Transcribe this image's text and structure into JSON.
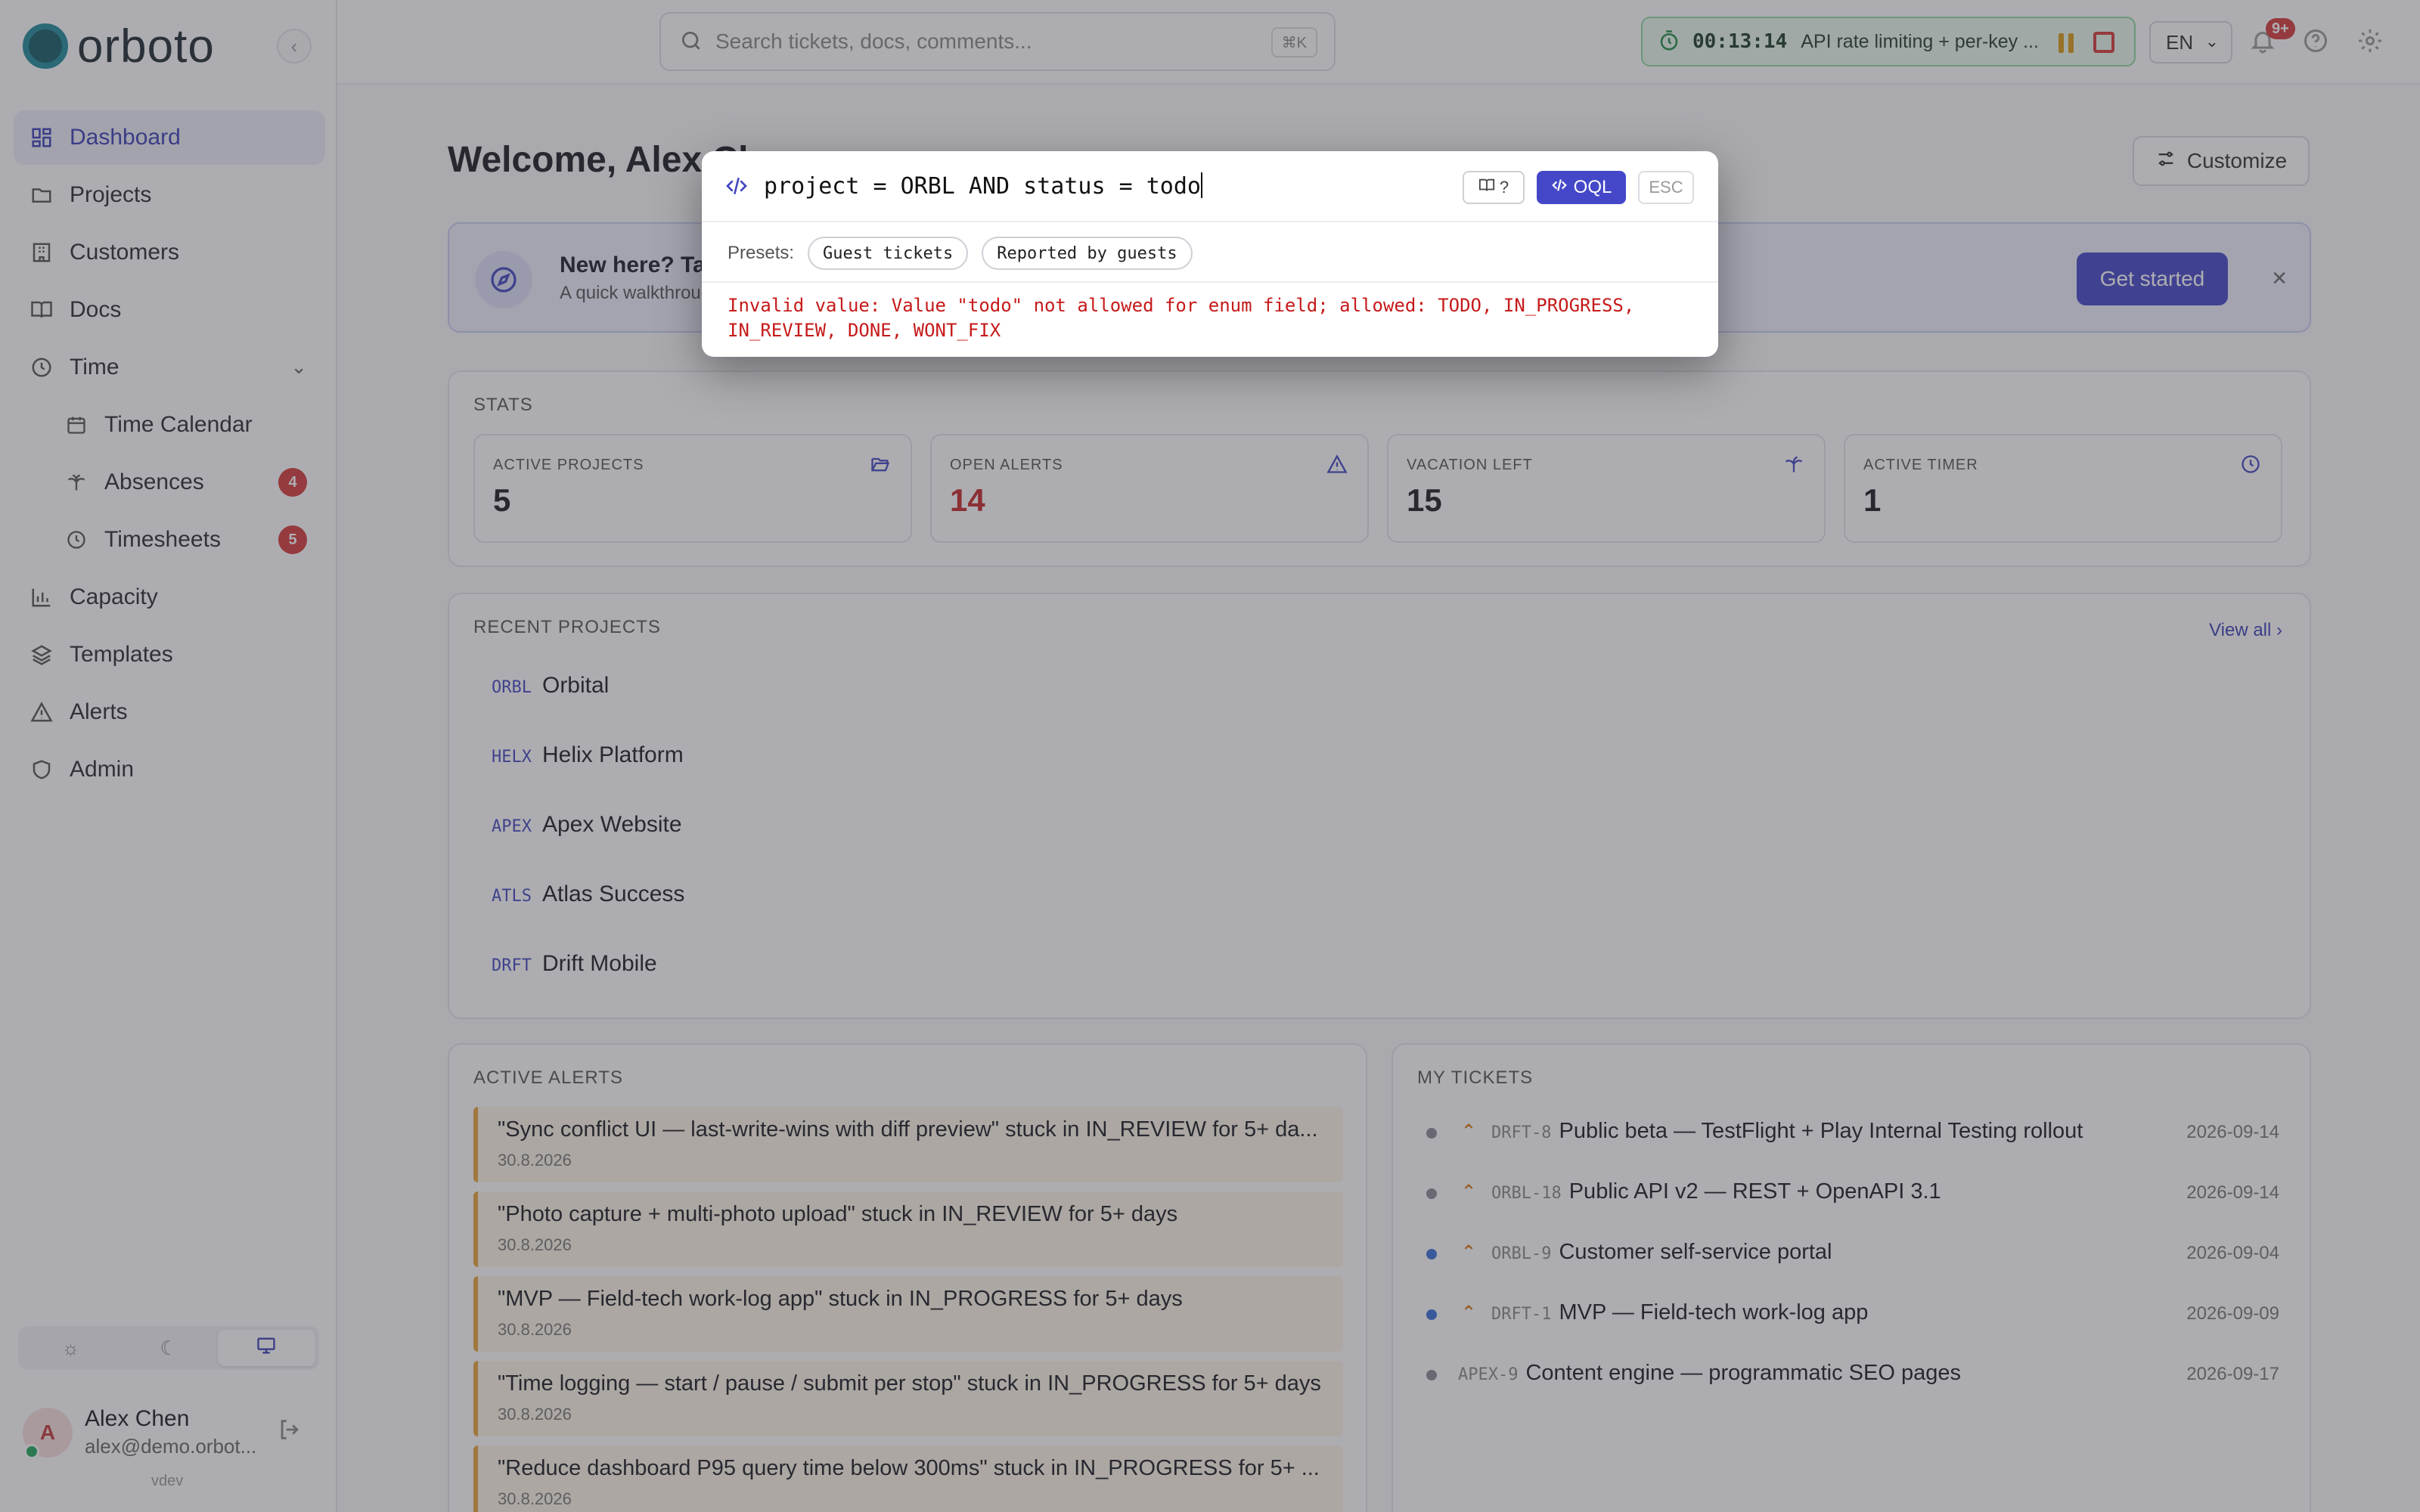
{
  "app": {
    "name": "orboto",
    "env": "vdev"
  },
  "sidebar": {
    "items": [
      {
        "label": "Dashboard",
        "icon": "dashboard-icon",
        "active": true
      },
      {
        "label": "Projects",
        "icon": "folder-icon"
      },
      {
        "label": "Customers",
        "icon": "building-icon"
      },
      {
        "label": "Docs",
        "icon": "book-icon"
      },
      {
        "label": "Time",
        "icon": "clock-icon",
        "expanded": true
      },
      {
        "label": "Time Calendar",
        "icon": "calendar-icon",
        "sub": true
      },
      {
        "label": "Absences",
        "icon": "palm-tree-icon",
        "sub": true,
        "badge": "4"
      },
      {
        "label": "Timesheets",
        "icon": "clock-icon",
        "sub": true,
        "badge": "5"
      },
      {
        "label": "Capacity",
        "icon": "bar-chart-icon"
      },
      {
        "label": "Templates",
        "icon": "layers-icon"
      },
      {
        "label": "Alerts",
        "icon": "alert-triangle-icon"
      },
      {
        "label": "Admin",
        "icon": "shield-icon"
      }
    ],
    "theme_options": [
      "light",
      "dark",
      "system"
    ],
    "theme_selected": "system"
  },
  "user": {
    "initial": "A",
    "name": "Alex Chen",
    "email": "alex@demo.orbot..."
  },
  "topbar": {
    "search_placeholder": "Search tickets, docs, comments...",
    "search_shortcut": "⌘K",
    "timer_time": "00:13:14",
    "timer_label": "API rate limiting + per-key ...",
    "language": "EN",
    "notifications_badge": "9+"
  },
  "main": {
    "welcome": "Welcome, Alex Chen",
    "customize_label": "Customize",
    "banner": {
      "title": "New here? Take a quick tour",
      "subtitle": "A quick walkthrough of the main features",
      "cta": "Get started"
    },
    "stats_title": "STATS",
    "stats": [
      {
        "label": "ACTIVE PROJECTS",
        "value": "5",
        "icon": "folder-open-icon"
      },
      {
        "label": "OPEN ALERTS",
        "value": "14",
        "icon": "alert-triangle-icon",
        "color": "#c62828"
      },
      {
        "label": "VACATION LEFT",
        "value": "15",
        "icon": "palm-tree-icon"
      },
      {
        "label": "ACTIVE TIMER",
        "value": "1",
        "icon": "clock-icon"
      }
    ],
    "recent_title": "RECENT PROJECTS",
    "view_all": "View all",
    "projects": [
      {
        "key": "ORBL",
        "name": "Orbital"
      },
      {
        "key": "HELX",
        "name": "Helix Platform"
      },
      {
        "key": "APEX",
        "name": "Apex Website"
      },
      {
        "key": "ATLS",
        "name": "Atlas Success"
      },
      {
        "key": "DRFT",
        "name": "Drift Mobile"
      }
    ],
    "alerts_title": "ACTIVE ALERTS",
    "alerts": [
      {
        "text": "\"Sync conflict UI — last-write-wins with diff preview\" stuck in IN_REVIEW for 5+ da...",
        "date": "30.8.2026"
      },
      {
        "text": "\"Photo capture + multi-photo upload\" stuck in IN_REVIEW for 5+ days",
        "date": "30.8.2026"
      },
      {
        "text": "\"MVP — Field-tech work-log app\" stuck in IN_PROGRESS for 5+ days",
        "date": "30.8.2026"
      },
      {
        "text": "\"Time logging — start / pause / submit per stop\" stuck in IN_PROGRESS for 5+ days",
        "date": "30.8.2026"
      },
      {
        "text": "\"Reduce dashboard P95 query time below 300ms\" stuck in IN_PROGRESS for 5+ ...",
        "date": "30.8.2026"
      }
    ],
    "tickets_title": "MY TICKETS",
    "tickets": [
      {
        "key": "DRFT-8",
        "title": "Public beta — TestFlight + Play Internal Testing rollout",
        "date": "2026-09-14",
        "status_color": "#8a8a94",
        "priority": "high"
      },
      {
        "key": "ORBL-18",
        "title": "Public API v2 — REST + OpenAPI 3.1",
        "date": "2026-09-14",
        "status_color": "#8a8a94",
        "priority": "high"
      },
      {
        "key": "ORBL-9",
        "title": "Customer self-service portal",
        "date": "2026-09-04",
        "status_color": "#3a6fd8",
        "priority": "high"
      },
      {
        "key": "DRFT-1",
        "title": "MVP — Field-tech work-log app",
        "date": "2026-09-09",
        "status_color": "#3a6fd8",
        "priority": "high"
      },
      {
        "key": "APEX-9",
        "title": "Content engine — programmatic SEO pages",
        "date": "2026-09-17",
        "status_color": "#8a8a94",
        "priority": "none"
      }
    ]
  },
  "query_modal": {
    "query": "project = ORBL AND status = todo",
    "doc_button": "?",
    "mode_button": "OQL",
    "esc_button": "ESC",
    "presets_label": "Presets:",
    "presets": [
      "Guest tickets",
      "Reported by guests"
    ],
    "error": "Invalid value: Value \"todo\" not allowed for enum field; allowed: TODO, IN_PROGRESS, IN_REVIEW, DONE, WONT_FIX"
  }
}
